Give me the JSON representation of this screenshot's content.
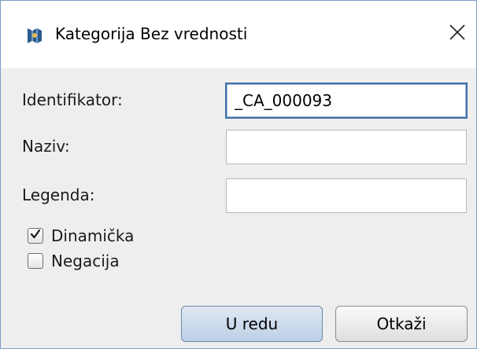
{
  "dialog": {
    "title": "Kategorija Bez vrednosti",
    "app_icon": "app-logo-icon",
    "close_icon": "close-icon"
  },
  "form": {
    "identifikator": {
      "label": "Identifikator:",
      "value": "_CA_000093"
    },
    "naziv": {
      "label": "Naziv:",
      "value": ""
    },
    "legenda": {
      "label": "Legenda:",
      "value": ""
    },
    "dinamicka": {
      "label": "Dinamička",
      "checked": true
    },
    "negacija": {
      "label": "Negacija",
      "checked": false
    }
  },
  "buttons": {
    "ok_label": "U redu",
    "cancel_label": "Otkaži"
  },
  "colors": {
    "window_bg": "#eeeeee",
    "titlebar_bg": "#ffffff",
    "focus_border": "#3f6fa9",
    "app_icon": "#2b5a8a"
  }
}
